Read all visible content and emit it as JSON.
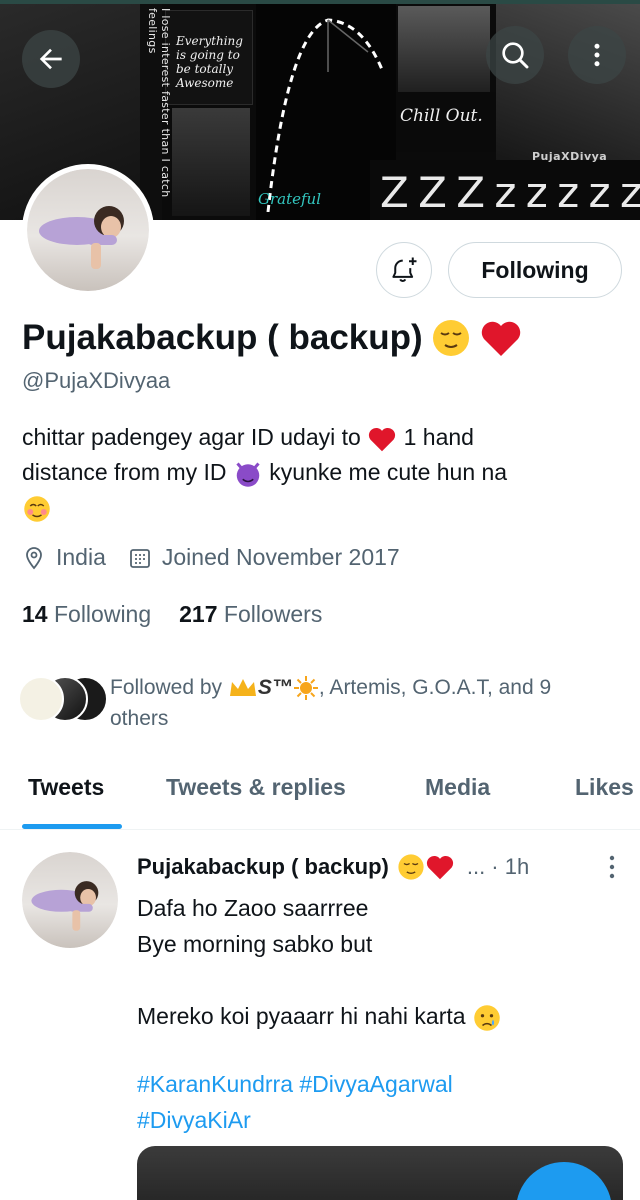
{
  "banner": {
    "vertical_text": "I lose interest faster than I catch feelings",
    "quote_text": "Everything is going to be totally Awesome",
    "chill_text": "Chill Out.",
    "grateful_text": "Grateful",
    "zzz_text": "Z Z Z z z z z z z",
    "watermark": "PujaXDivya"
  },
  "header": {
    "back_icon": "arrow-left-icon",
    "search_icon": "search-icon",
    "more_icon": "more-vertical-icon"
  },
  "profile": {
    "name": "Pujakabackup ( backup)",
    "name_emojis": [
      "relieved-face",
      "red-heart"
    ],
    "handle": "@PujaXDivyaa",
    "bio_line1": "chittar padengey agar ID udayi to",
    "bio_line1_after": "1 hand",
    "bio_line2_pre": "distance from my ID",
    "bio_line2_post": "kyunke me cute hun na",
    "location": "India",
    "joined": "Joined November 2017",
    "following_count": "14",
    "following_label": "Following",
    "followers_count": "217",
    "followers_label": "Followers",
    "followed_by_prefix": "Followed by",
    "followed_by_name1": "S™",
    "followed_by_rest": ", Artemis, G.O.A.T, and 9 others",
    "notify_button_icon": "bell-plus-icon",
    "following_button": "Following"
  },
  "tabs": [
    {
      "label": "Tweets",
      "active": true
    },
    {
      "label": "Tweets & replies",
      "active": false
    },
    {
      "label": "Media",
      "active": false
    },
    {
      "label": "Likes",
      "active": false
    }
  ],
  "tweet": {
    "author": "Pujakabackup ( backup)",
    "meta": "... · 1h",
    "lines": [
      "Dafa ho Zaoo  saarrree",
      "Bye morning sabko but",
      "",
      "Mereko koi pyaaarr hi nahi karta"
    ],
    "hashtag_line1": "#KaranKundrra #DivyaAgarwal",
    "hashtag_line2": "#DivyaKiAr"
  },
  "colors": {
    "accent": "#1d9bf0",
    "text_primary": "#0f1419",
    "text_secondary": "#536471"
  }
}
